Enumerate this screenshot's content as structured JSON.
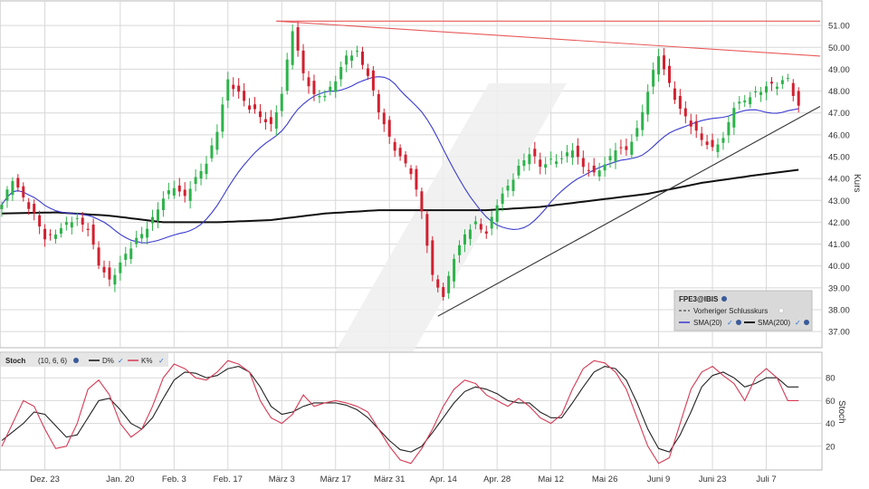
{
  "colors": {
    "up": "#2db34a",
    "down": "#d2202f",
    "sma20": "#3a3ad0",
    "sma200": "#111111",
    "trend_resistance": "#e85a5a",
    "trend_support": "#333333",
    "stoch_k": "#d63a55",
    "stoch_d": "#222222",
    "grid": "#d8d8d8",
    "legend_bg": "#d8d8d8"
  },
  "legend": {
    "symbol": "FPE3@IBIS",
    "prev_close": "Vorheriger Schlusskurs",
    "sma20": "SMA(20)",
    "sma200": "SMA(200)"
  },
  "stoch_header": {
    "title": "Stoch",
    "params": "(10, 6, 6)",
    "d_label": "D%",
    "k_label": "K%"
  },
  "chart_data": [
    {
      "type": "candlestick",
      "ylabel": "Kurs",
      "ylim": [
        36.3,
        52.0
      ],
      "yticks": [
        37,
        38,
        39,
        40,
        41,
        42,
        43,
        44,
        45,
        46,
        47,
        48,
        49,
        50,
        51
      ],
      "ytick_labels": [
        "37.00",
        "38.00",
        "39.00",
        "40.00",
        "41.00",
        "42.00",
        "43.00",
        "44.00",
        "45.00",
        "46.00",
        "47.00",
        "48.00",
        "49.00",
        "50.00",
        "51.00"
      ],
      "x_labels": [
        "Dez. 23",
        "Jan. 20",
        "Feb. 3",
        "Feb. 17",
        "März 3",
        "März 17",
        "März 31",
        "Apr. 14",
        "Apr. 28",
        "Mai 12",
        "Mai 26",
        "Juni 9",
        "Juni 23",
        "Juli 7"
      ],
      "x_label_days": [
        8,
        22,
        32,
        42,
        52,
        62,
        72,
        82,
        92,
        102,
        112,
        122,
        132,
        142
      ],
      "x_range": [
        0,
        152
      ],
      "close_anchors": [
        [
          0,
          42.8
        ],
        [
          2,
          43.9
        ],
        [
          4,
          43.2
        ],
        [
          6,
          42.3
        ],
        [
          8,
          41.2
        ],
        [
          10,
          41.6
        ],
        [
          12,
          41.9
        ],
        [
          14,
          42.1
        ],
        [
          16,
          41.8
        ],
        [
          18,
          40.0
        ],
        [
          20,
          39.3
        ],
        [
          22,
          40.2
        ],
        [
          24,
          40.8
        ],
        [
          26,
          41.5
        ],
        [
          28,
          42.2
        ],
        [
          30,
          43.0
        ],
        [
          32,
          43.7
        ],
        [
          34,
          43.2
        ],
        [
          36,
          43.9
        ],
        [
          38,
          44.8
        ],
        [
          40,
          46.2
        ],
        [
          42,
          48.4
        ],
        [
          44,
          48.0
        ],
        [
          46,
          47.2
        ],
        [
          48,
          46.8
        ],
        [
          50,
          46.5
        ],
        [
          52,
          47.8
        ],
        [
          54,
          50.8
        ],
        [
          56,
          48.9
        ],
        [
          58,
          47.7
        ],
        [
          60,
          47.8
        ],
        [
          62,
          48.6
        ],
        [
          64,
          49.5
        ],
        [
          66,
          49.8
        ],
        [
          68,
          48.8
        ],
        [
          70,
          47.0
        ],
        [
          72,
          45.9
        ],
        [
          74,
          45.0
        ],
        [
          76,
          44.2
        ],
        [
          78,
          42.6
        ],
        [
          80,
          39.5
        ],
        [
          82,
          38.5
        ],
        [
          84,
          40.5
        ],
        [
          86,
          41.4
        ],
        [
          88,
          41.9
        ],
        [
          90,
          41.6
        ],
        [
          92,
          42.8
        ],
        [
          94,
          43.6
        ],
        [
          96,
          44.6
        ],
        [
          98,
          45.1
        ],
        [
          100,
          44.6
        ],
        [
          102,
          44.9
        ],
        [
          104,
          44.8
        ],
        [
          106,
          45.4
        ],
        [
          108,
          44.6
        ],
        [
          110,
          44.1
        ],
        [
          112,
          44.7
        ],
        [
          114,
          45.4
        ],
        [
          116,
          45.2
        ],
        [
          118,
          46.3
        ],
        [
          120,
          48.0
        ],
        [
          122,
          49.6
        ],
        [
          124,
          48.4
        ],
        [
          126,
          47.1
        ],
        [
          128,
          46.4
        ],
        [
          130,
          45.9
        ],
        [
          132,
          45.3
        ],
        [
          134,
          45.8
        ],
        [
          136,
          47.4
        ],
        [
          138,
          47.5
        ],
        [
          140,
          47.9
        ],
        [
          142,
          48.3
        ],
        [
          144,
          48.2
        ],
        [
          146,
          48.6
        ],
        [
          148,
          47.3
        ]
      ],
      "sma200_anchors": [
        [
          0,
          42.4
        ],
        [
          10,
          42.45
        ],
        [
          20,
          42.3
        ],
        [
          30,
          42.0
        ],
        [
          40,
          42.0
        ],
        [
          50,
          42.1
        ],
        [
          60,
          42.4
        ],
        [
          70,
          42.55
        ],
        [
          80,
          42.55
        ],
        [
          90,
          42.55
        ],
        [
          100,
          42.7
        ],
        [
          110,
          43.0
        ],
        [
          120,
          43.3
        ],
        [
          130,
          43.8
        ],
        [
          140,
          44.15
        ],
        [
          148,
          44.4
        ]
      ],
      "trendlines": [
        {
          "name": "resistance",
          "points": [
            [
              51,
              51.2
            ],
            [
              152,
              49.6
            ]
          ]
        },
        {
          "name": "upper",
          "points": [
            [
              51,
              51.2
            ],
            [
              152,
              51.2
            ]
          ]
        },
        {
          "name": "support",
          "points": [
            [
              81,
              37.7
            ],
            [
              152,
              47.3
            ]
          ]
        }
      ]
    },
    {
      "type": "line",
      "title": "Stoch",
      "ylim": [
        0,
        100
      ],
      "yticks": [
        20,
        40,
        60,
        80
      ],
      "ytick_labels": [
        "20",
        "40",
        "60",
        "80"
      ],
      "ylabel": "Stoch",
      "k_anchors": [
        [
          0,
          20
        ],
        [
          2,
          40
        ],
        [
          4,
          60
        ],
        [
          6,
          55
        ],
        [
          8,
          35
        ],
        [
          10,
          18
        ],
        [
          12,
          20
        ],
        [
          14,
          40
        ],
        [
          16,
          70
        ],
        [
          18,
          78
        ],
        [
          20,
          65
        ],
        [
          22,
          40
        ],
        [
          24,
          28
        ],
        [
          26,
          35
        ],
        [
          28,
          55
        ],
        [
          30,
          80
        ],
        [
          32,
          92
        ],
        [
          34,
          88
        ],
        [
          36,
          80
        ],
        [
          38,
          78
        ],
        [
          40,
          85
        ],
        [
          42,
          95
        ],
        [
          44,
          92
        ],
        [
          46,
          85
        ],
        [
          48,
          60
        ],
        [
          50,
          45
        ],
        [
          52,
          40
        ],
        [
          54,
          48
        ],
        [
          56,
          65
        ],
        [
          58,
          55
        ],
        [
          60,
          58
        ],
        [
          62,
          60
        ],
        [
          64,
          58
        ],
        [
          66,
          55
        ],
        [
          68,
          50
        ],
        [
          70,
          35
        ],
        [
          72,
          20
        ],
        [
          74,
          8
        ],
        [
          76,
          5
        ],
        [
          78,
          18
        ],
        [
          80,
          35
        ],
        [
          82,
          55
        ],
        [
          84,
          70
        ],
        [
          86,
          78
        ],
        [
          88,
          75
        ],
        [
          90,
          65
        ],
        [
          92,
          60
        ],
        [
          94,
          55
        ],
        [
          96,
          62
        ],
        [
          98,
          55
        ],
        [
          100,
          45
        ],
        [
          102,
          40
        ],
        [
          104,
          48
        ],
        [
          106,
          70
        ],
        [
          108,
          88
        ],
        [
          110,
          95
        ],
        [
          112,
          93
        ],
        [
          114,
          85
        ],
        [
          116,
          70
        ],
        [
          118,
          45
        ],
        [
          120,
          20
        ],
        [
          122,
          5
        ],
        [
          124,
          10
        ],
        [
          126,
          40
        ],
        [
          128,
          70
        ],
        [
          130,
          85
        ],
        [
          132,
          90
        ],
        [
          134,
          82
        ],
        [
          136,
          75
        ],
        [
          138,
          60
        ],
        [
          140,
          80
        ],
        [
          142,
          88
        ],
        [
          144,
          80
        ],
        [
          146,
          60
        ]
      ],
      "d_anchors": [
        [
          0,
          25
        ],
        [
          4,
          40
        ],
        [
          6,
          50
        ],
        [
          8,
          48
        ],
        [
          10,
          38
        ],
        [
          12,
          28
        ],
        [
          14,
          30
        ],
        [
          16,
          45
        ],
        [
          18,
          60
        ],
        [
          20,
          62
        ],
        [
          22,
          52
        ],
        [
          24,
          40
        ],
        [
          26,
          35
        ],
        [
          28,
          45
        ],
        [
          30,
          62
        ],
        [
          32,
          78
        ],
        [
          34,
          85
        ],
        [
          36,
          84
        ],
        [
          38,
          80
        ],
        [
          40,
          82
        ],
        [
          42,
          88
        ],
        [
          44,
          90
        ],
        [
          46,
          85
        ],
        [
          48,
          72
        ],
        [
          50,
          55
        ],
        [
          52,
          48
        ],
        [
          54,
          50
        ],
        [
          56,
          55
        ],
        [
          58,
          58
        ],
        [
          60,
          58
        ],
        [
          62,
          58
        ],
        [
          64,
          56
        ],
        [
          66,
          52
        ],
        [
          68,
          45
        ],
        [
          70,
          35
        ],
        [
          72,
          25
        ],
        [
          74,
          17
        ],
        [
          76,
          15
        ],
        [
          78,
          20
        ],
        [
          80,
          32
        ],
        [
          82,
          45
        ],
        [
          84,
          58
        ],
        [
          86,
          68
        ],
        [
          88,
          72
        ],
        [
          90,
          70
        ],
        [
          92,
          66
        ],
        [
          94,
          60
        ],
        [
          96,
          58
        ],
        [
          98,
          58
        ],
        [
          100,
          50
        ],
        [
          102,
          45
        ],
        [
          104,
          45
        ],
        [
          106,
          58
        ],
        [
          108,
          72
        ],
        [
          110,
          85
        ],
        [
          112,
          90
        ],
        [
          114,
          88
        ],
        [
          116,
          78
        ],
        [
          118,
          58
        ],
        [
          120,
          35
        ],
        [
          122,
          18
        ],
        [
          124,
          15
        ],
        [
          126,
          30
        ],
        [
          128,
          50
        ],
        [
          130,
          72
        ],
        [
          132,
          82
        ],
        [
          134,
          85
        ],
        [
          136,
          80
        ],
        [
          138,
          72
        ],
        [
          140,
          75
        ],
        [
          142,
          80
        ],
        [
          144,
          80
        ],
        [
          146,
          72
        ]
      ]
    }
  ]
}
